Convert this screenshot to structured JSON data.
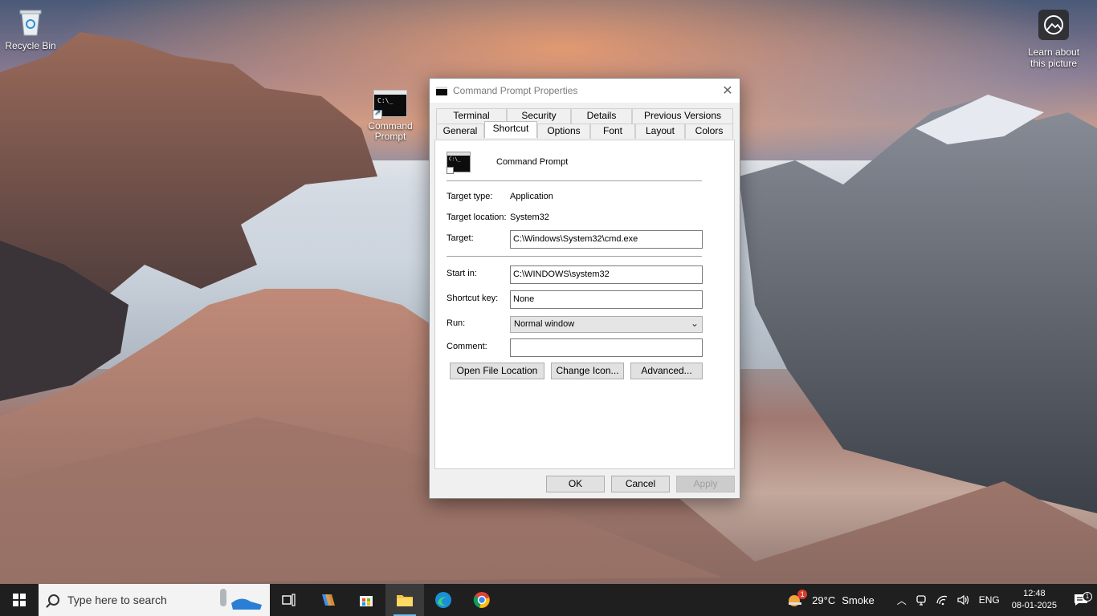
{
  "desktop": {
    "icons": [
      {
        "label": "Recycle Bin",
        "icon": "recycle-bin-icon"
      },
      {
        "label": "Command\nPrompt",
        "line1": "Command",
        "line2": "Prompt",
        "icon": "command-prompt-icon"
      },
      {
        "label": "Learn about this picture",
        "line1": "Learn about",
        "line2": "this picture",
        "icon": "learn-picture-icon"
      }
    ]
  },
  "dialog": {
    "title": "Command Prompt Properties",
    "tabs_row1": [
      "Terminal",
      "Security",
      "Details",
      "Previous Versions"
    ],
    "tabs_row2": [
      "General",
      "Shortcut",
      "Options",
      "Font",
      "Layout",
      "Colors"
    ],
    "active_tab": "Shortcut",
    "icon_glyph": "C:\\_",
    "shortcut_name": "Command Prompt",
    "target_type_label": "Target type:",
    "target_type_value": "Application",
    "target_location_label": "Target location:",
    "target_location_value": "System32",
    "target_label": "Target:",
    "target_value": "C:\\Windows\\System32\\cmd.exe",
    "start_in_label": "Start in:",
    "start_in_value": "C:\\WINDOWS\\system32",
    "shortcut_key_label": "Shortcut key:",
    "shortcut_key_value": "None",
    "run_label": "Run:",
    "run_value": "Normal window",
    "comment_label": "Comment:",
    "comment_value": "",
    "buttons": {
      "open_file_location": "Open File Location",
      "change_icon": "Change Icon...",
      "advanced": "Advanced...",
      "ok": "OK",
      "cancel": "Cancel",
      "apply": "Apply"
    }
  },
  "taskbar": {
    "search_placeholder": "Type here to search",
    "weather": {
      "temp": "29°C",
      "condition": "Smoke",
      "badge": "1"
    },
    "language": "ENG",
    "time": "12:48",
    "date": "08-01-2025",
    "notification_count": "1"
  },
  "colors": {
    "taskbar_bg": "#1f1f1f",
    "accent": "#76b9ed"
  }
}
